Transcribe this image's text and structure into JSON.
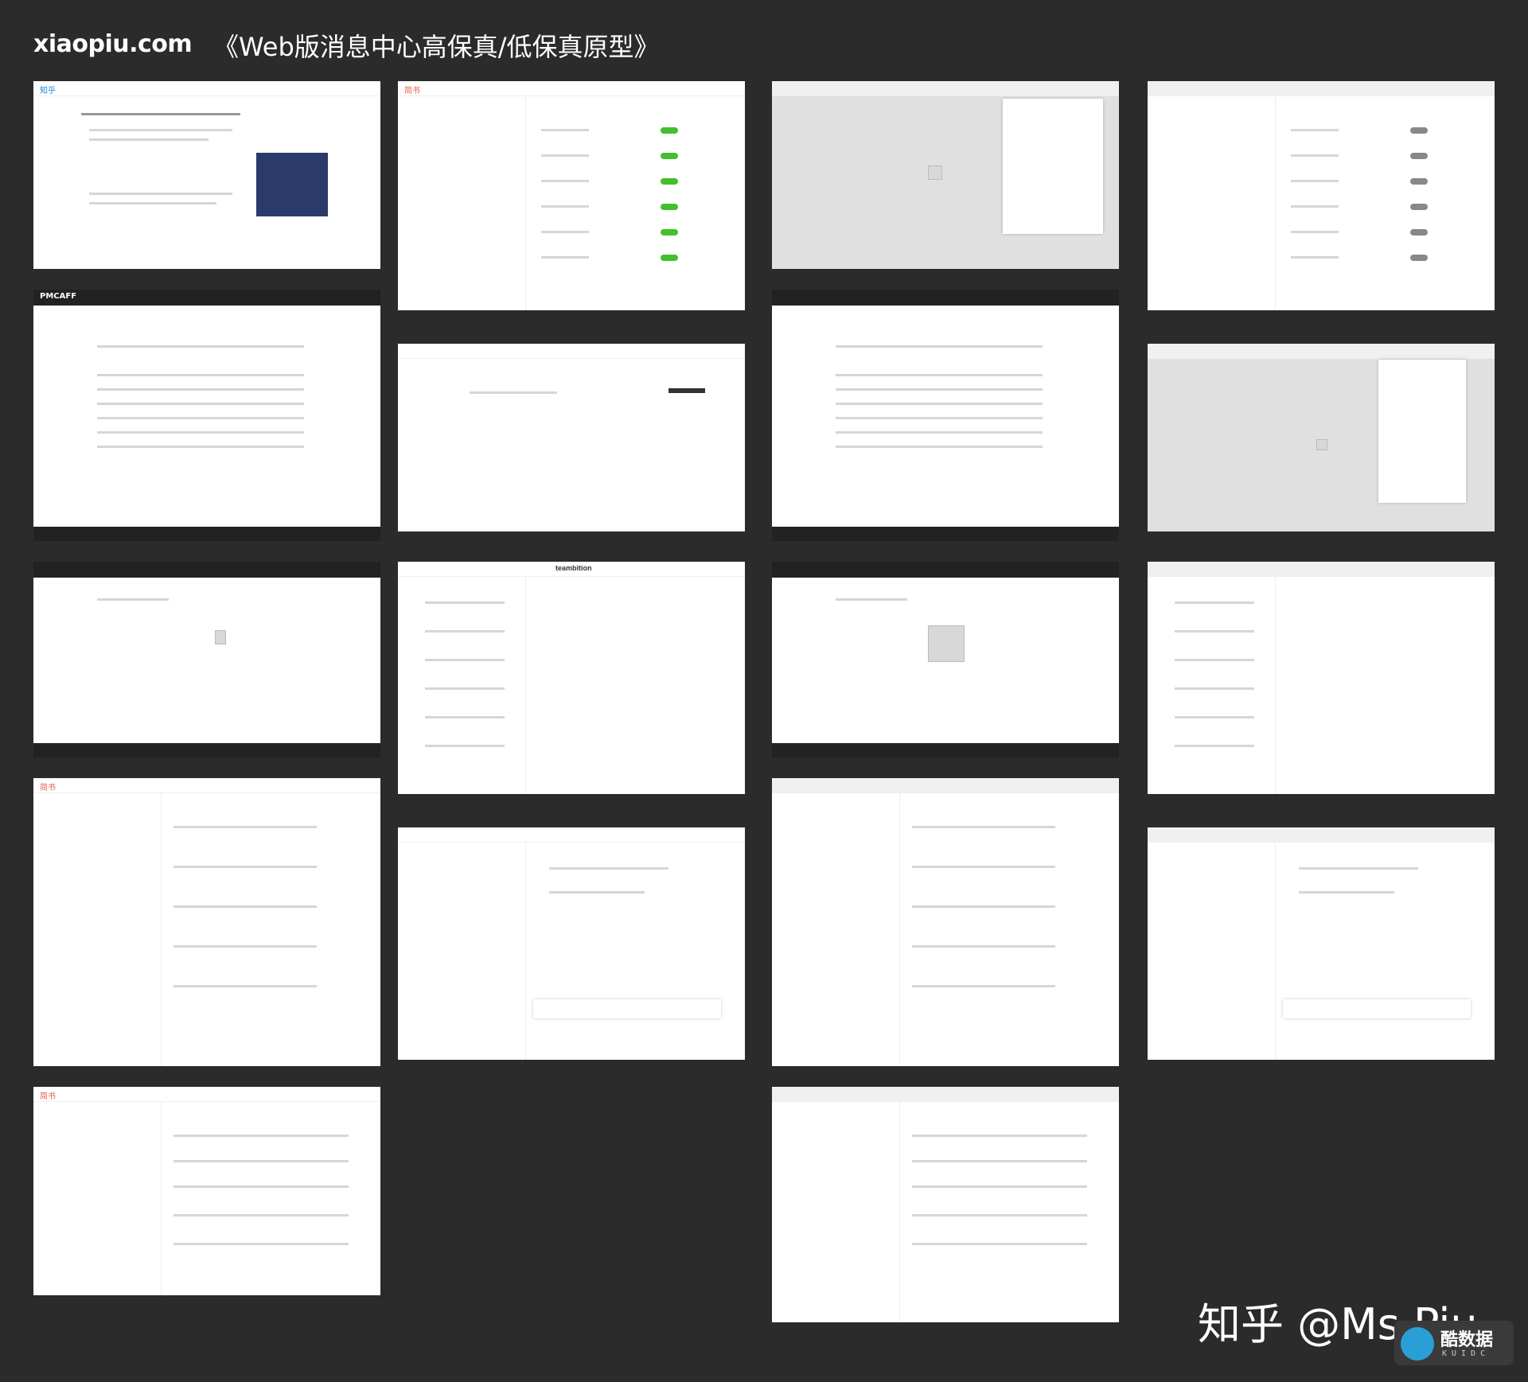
{
  "header": {
    "brand": "xiaopiu.com",
    "title": "《Web版消息中心高保真/低保真原型》"
  },
  "logos": {
    "zhihu": "知乎",
    "jianshu": "简书",
    "pmcaff": "PMCAFF",
    "teambition": "teambition"
  },
  "watermark": "知乎 @Ms Piu",
  "corner_badge": {
    "title": "酷数据",
    "subtitle": "KUIDC"
  },
  "colors": {
    "background": "#2b2b2b",
    "jianshu_red": "#e8604c",
    "follow_green": "#42c02e",
    "zhihu_blue": "#0f88eb"
  }
}
